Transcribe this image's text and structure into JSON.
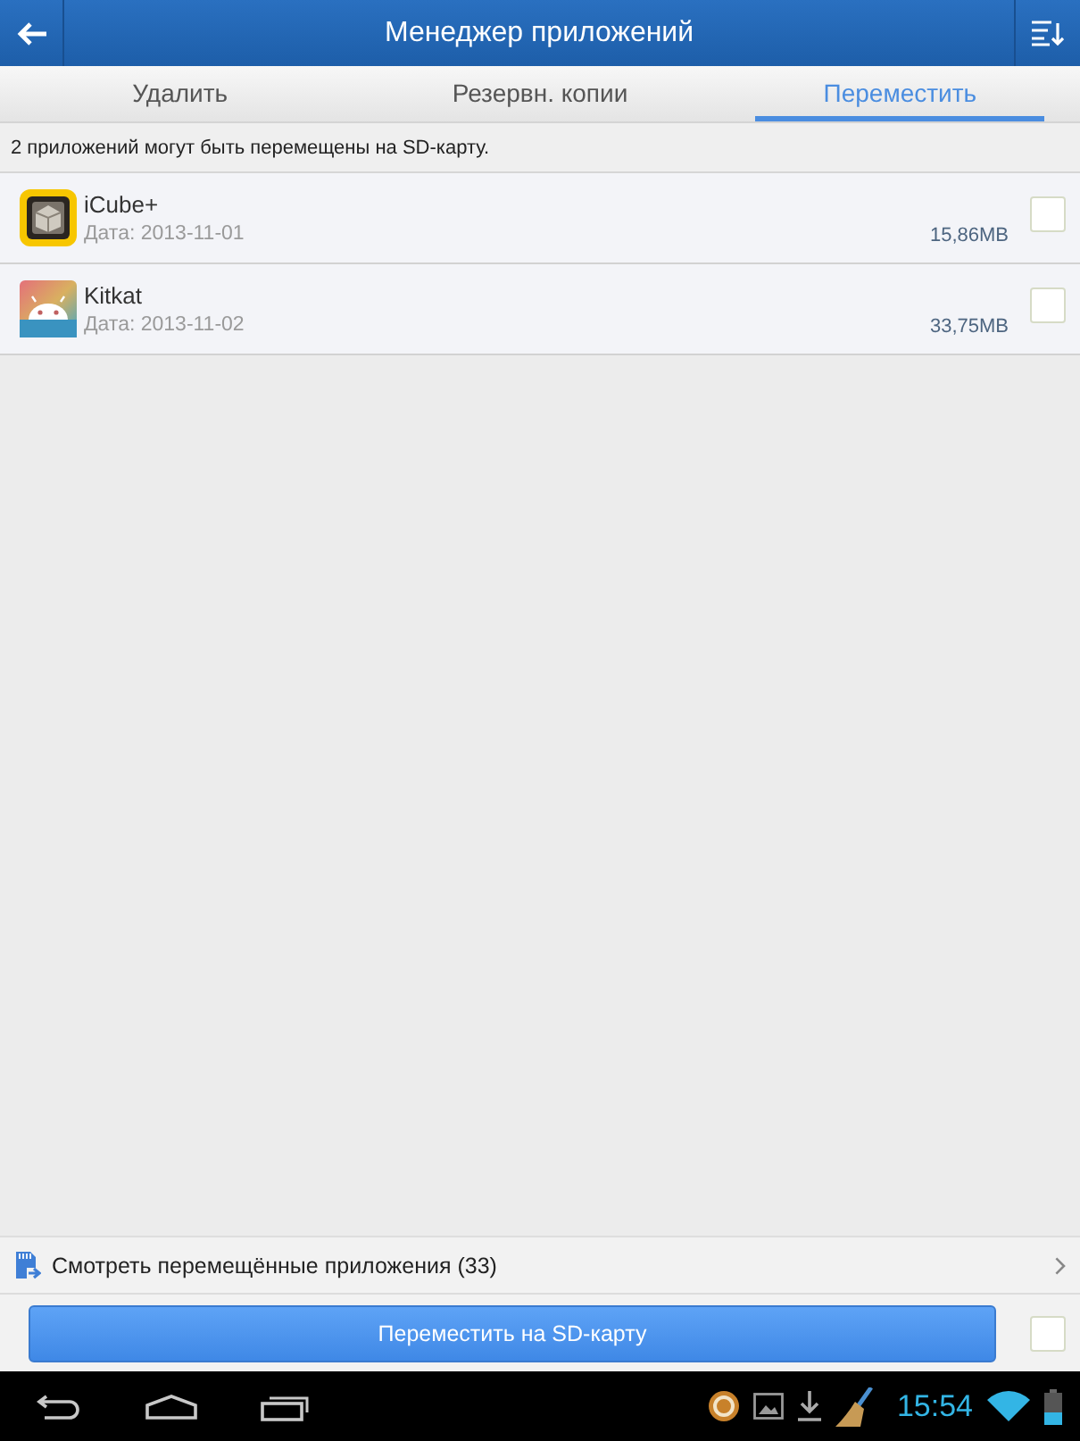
{
  "header": {
    "title": "Менеджер приложений"
  },
  "tabs": [
    {
      "label": "Удалить",
      "selected": false
    },
    {
      "label": "Резервн. копии",
      "selected": false
    },
    {
      "label": "Переместить",
      "selected": true
    }
  ],
  "info": "2 приложений могут быть перемещены на SD-карту.",
  "apps": [
    {
      "kind": "cube",
      "name": "iCube+",
      "date": "Дата: 2013-11-01",
      "size": "15,86MB",
      "checked": false
    },
    {
      "kind": "android",
      "name": "Kitkat",
      "date": "Дата: 2013-11-02",
      "size": "33,75MB",
      "checked": false
    }
  ],
  "moved_link": {
    "label": "Смотреть перемещённые приложения (33)"
  },
  "action": {
    "label": "Переместить на SD-карту",
    "select_all_checked": false
  },
  "status_bar": {
    "time": "15:54"
  }
}
